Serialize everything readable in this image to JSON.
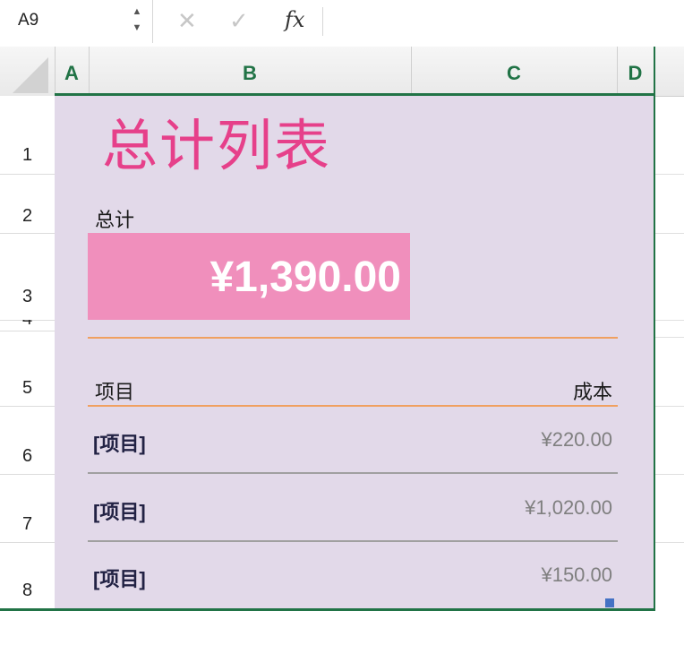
{
  "name_box": {
    "value": "A9"
  },
  "formula_bar": {
    "cancel_icon": "✕",
    "enter_icon": "✓",
    "fx_label": "fx",
    "value": ""
  },
  "columns": [
    "A",
    "B",
    "C",
    "D"
  ],
  "rows": [
    "1",
    "2",
    "3",
    "4",
    "5",
    "6",
    "7",
    "8"
  ],
  "sheet": {
    "title": "总计列表",
    "total_label": "总计",
    "total_value": "¥1,390.00",
    "item_header": "项目",
    "cost_header": "成本",
    "items": [
      {
        "name": "[项目]",
        "cost": "¥220.00"
      },
      {
        "name": "[项目]",
        "cost": "¥1,020.00"
      },
      {
        "name": "[项目]",
        "cost": "¥150.00"
      }
    ]
  },
  "colors": {
    "accent": "#217346",
    "sheet_bg": "#e2d9e9",
    "title": "#e6408a",
    "total_fill": "#f08fbc",
    "rule": "#f0a060"
  }
}
